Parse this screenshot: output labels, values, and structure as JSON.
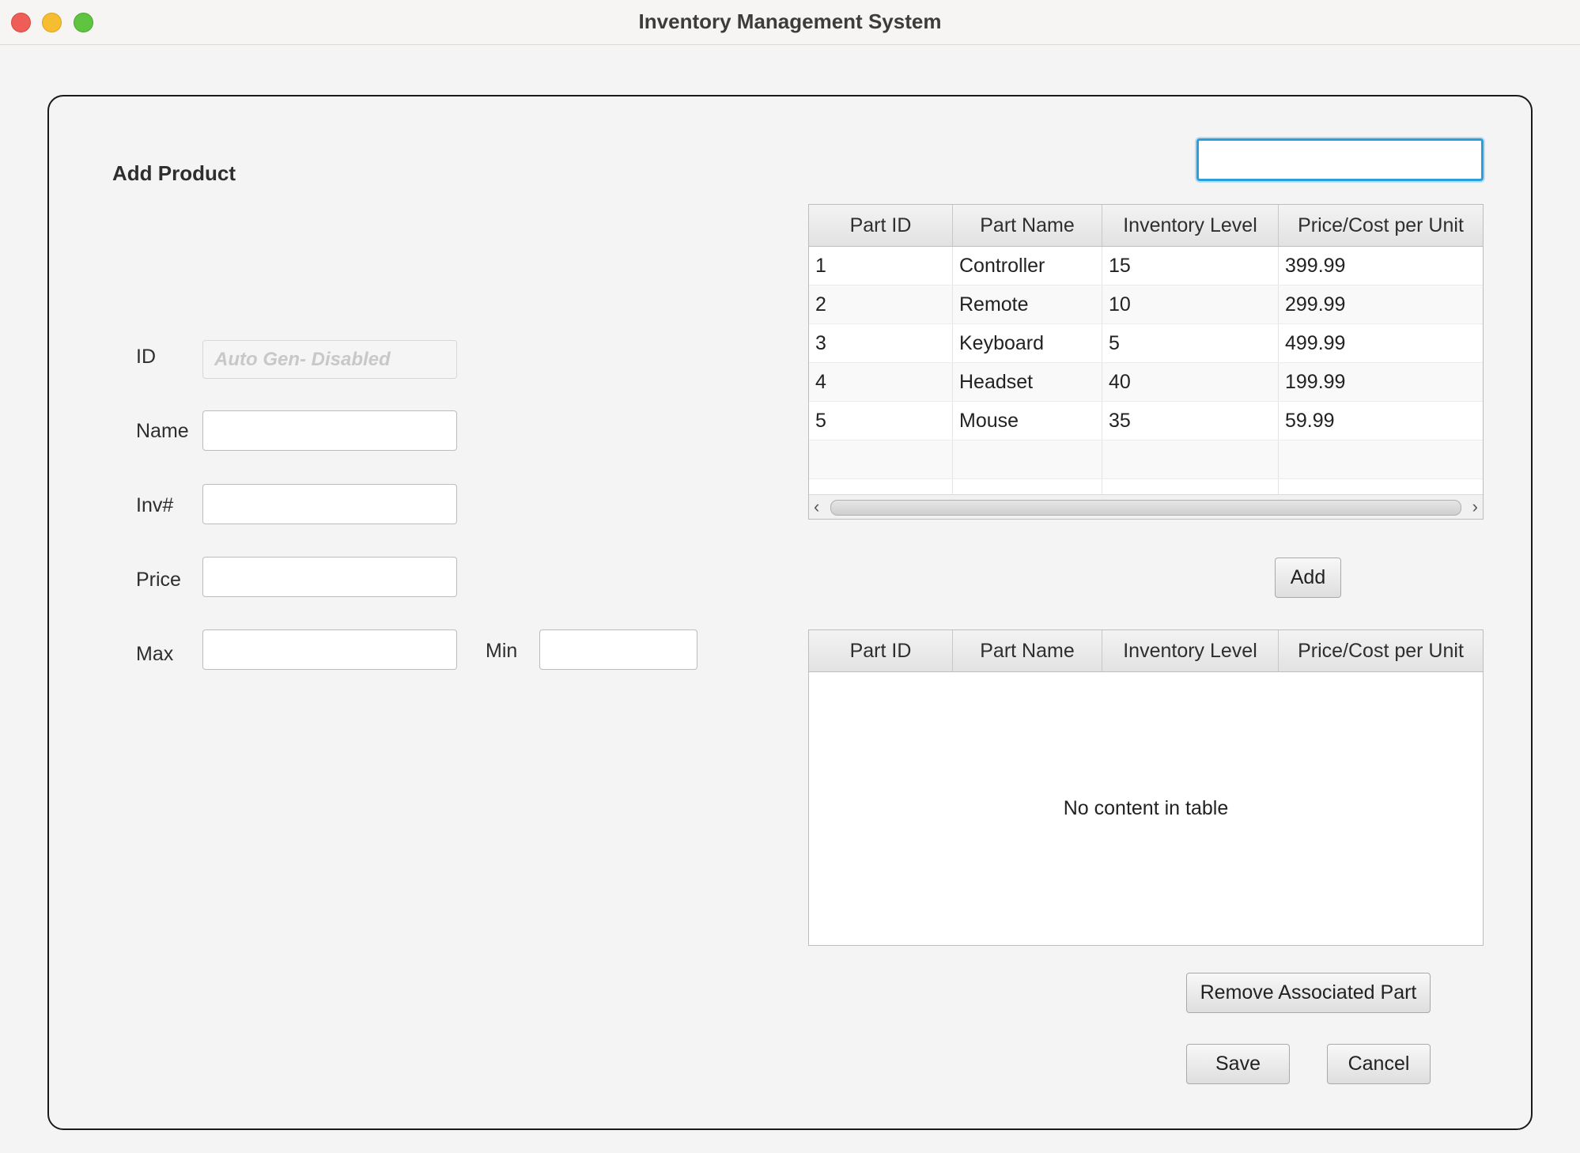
{
  "window": {
    "title": "Inventory Management System"
  },
  "form": {
    "heading": "Add Product",
    "id_label": "ID",
    "id_placeholder": "Auto Gen- Disabled",
    "name_label": "Name",
    "name_value": "",
    "inv_label": "Inv#",
    "inv_value": "",
    "price_label": "Price",
    "price_value": "",
    "max_label": "Max",
    "max_value": "",
    "min_label": "Min",
    "min_value": ""
  },
  "search": {
    "value": ""
  },
  "parts_table": {
    "columns": [
      "Part ID",
      "Part Name",
      "Inventory Level",
      "Price/Cost per Unit"
    ],
    "rows": [
      [
        "1",
        "Controller",
        "15",
        "399.99"
      ],
      [
        "2",
        "Remote",
        "10",
        "299.99"
      ],
      [
        "3",
        "Keyboard",
        "5",
        "499.99"
      ],
      [
        "4",
        "Headset",
        "40",
        "199.99"
      ],
      [
        "5",
        "Mouse",
        "35",
        "59.99"
      ]
    ]
  },
  "add_button": "Add",
  "associated_table": {
    "columns": [
      "Part ID",
      "Part Name",
      "Inventory Level",
      "Price/Cost per Unit"
    ],
    "empty_message": "No content in table"
  },
  "buttons": {
    "remove": "Remove Associated Part",
    "save": "Save",
    "cancel": "Cancel"
  },
  "icons": {
    "scroll_left": "‹",
    "scroll_right": "›"
  },
  "colors": {
    "close": "#ee5e57",
    "minimize": "#f6bd31",
    "maximize": "#5fc440",
    "focus_ring": "#2b9fda"
  }
}
